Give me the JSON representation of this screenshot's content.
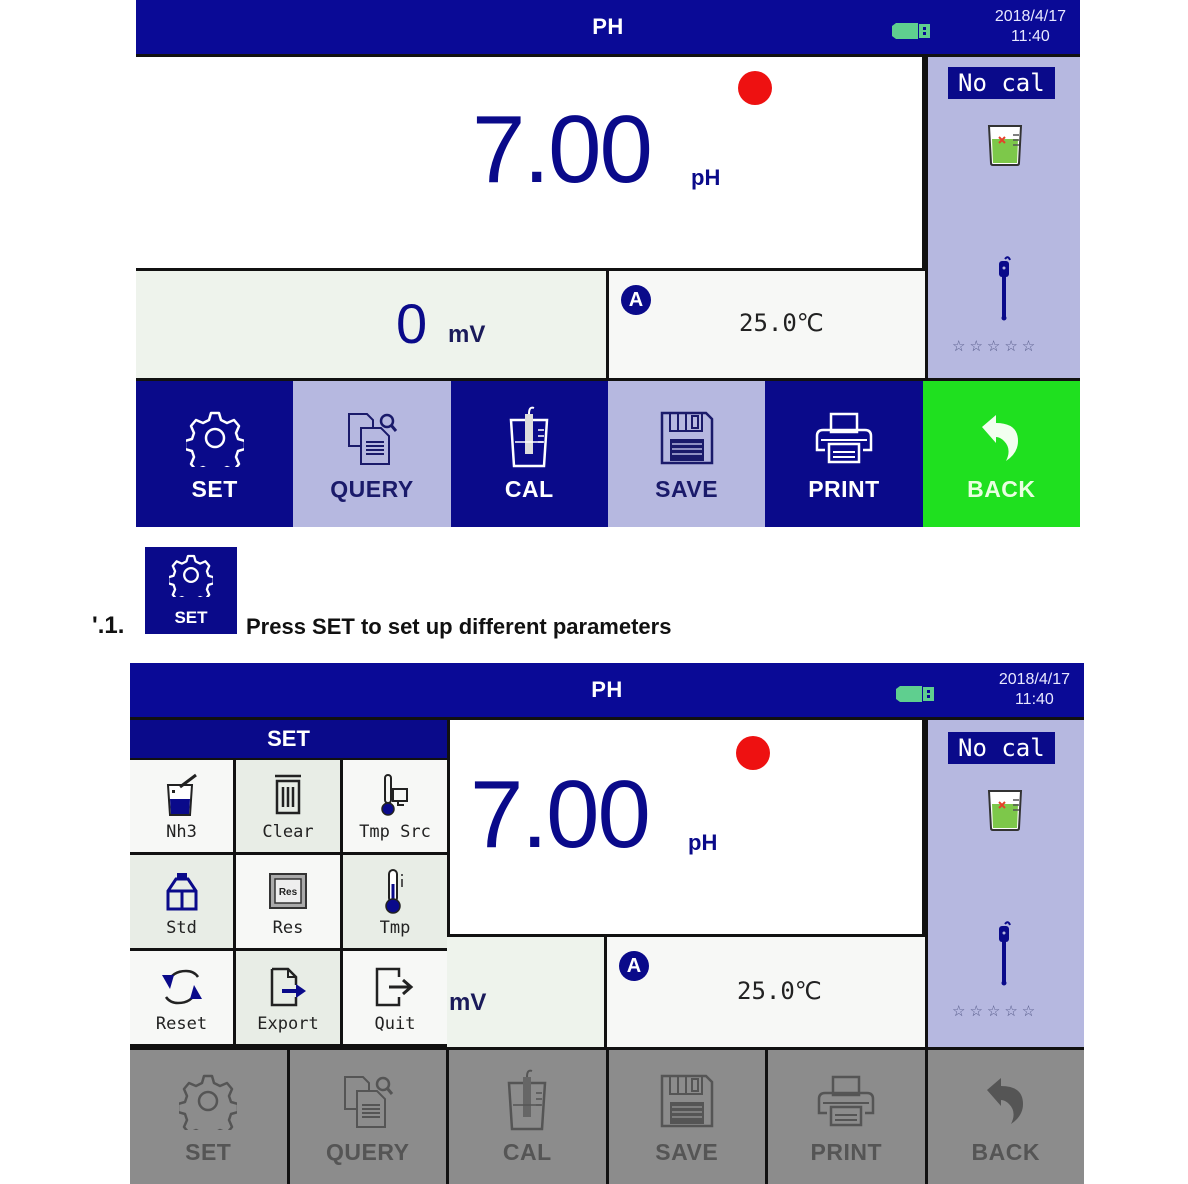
{
  "screen1": {
    "title": "PH",
    "date": "2018/4/17",
    "time": "11:40",
    "main_value": "7.00",
    "main_unit": "pH",
    "calibration_status": "No cal",
    "electrode_rating": "☆☆☆☆☆",
    "mv_value": "0",
    "mv_unit": "mV",
    "temp_mode_badge": "A",
    "temperature": "25.0℃",
    "buttons": [
      {
        "label": "SET"
      },
      {
        "label": "QUERY"
      },
      {
        "label": "CAL"
      },
      {
        "label": "SAVE"
      },
      {
        "label": "PRINT"
      },
      {
        "label": "BACK"
      }
    ]
  },
  "doc": {
    "section_number": "'.1.",
    "set_icon_label": "SET",
    "instruction": "Press SET to set up different parameters"
  },
  "screen2": {
    "title": "PH",
    "date": "2018/4/17",
    "time": "11:40",
    "main_value": "7.00",
    "main_unit": "pH",
    "calibration_status": "No cal",
    "electrode_rating": "☆☆☆☆☆",
    "mv_unit": "mV",
    "temp_mode_badge": "A",
    "temperature": "25.0℃",
    "set_menu": {
      "title": "SET",
      "items": [
        {
          "label": "Nh3",
          "icon": "beaker-pipette-icon"
        },
        {
          "label": "Clear",
          "icon": "trash-icon"
        },
        {
          "label": "Tmp Src",
          "icon": "thermometer-monitor-icon"
        },
        {
          "label": "Std",
          "icon": "bottles-icon"
        },
        {
          "label": "Res",
          "icon": "res-chip-icon"
        },
        {
          "label": "Tmp",
          "icon": "thermometer-icon"
        },
        {
          "label": "Reset",
          "icon": "refresh-icon"
        },
        {
          "label": "Export",
          "icon": "export-file-icon"
        },
        {
          "label": "Quit",
          "icon": "exit-icon"
        }
      ]
    },
    "buttons": [
      {
        "label": "SET"
      },
      {
        "label": "QUERY"
      },
      {
        "label": "CAL"
      },
      {
        "label": "SAVE"
      },
      {
        "label": "PRINT"
      },
      {
        "label": "BACK"
      }
    ]
  },
  "colors": {
    "navy": "#0a0a8a",
    "lavender": "#b6b8e0",
    "green": "#1fe01f",
    "red_indicator": "#ee1111",
    "disabled_grey": "#8c8c8c"
  }
}
